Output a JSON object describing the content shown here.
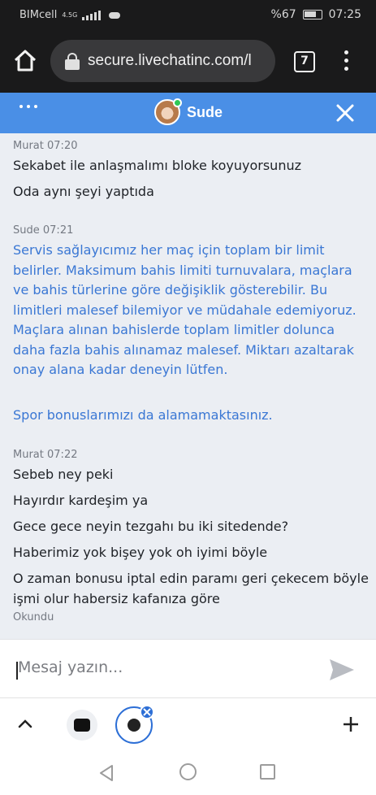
{
  "status_bar": {
    "carrier": "BIMcell",
    "network": "4.5G",
    "battery": "%67",
    "time": "07:25"
  },
  "browser": {
    "url": "secure.livechatinc.com/l",
    "tab_count": "7",
    "icons": {
      "home": "home-icon",
      "lock": "lock-icon",
      "menu": "kebab-menu-icon"
    }
  },
  "chat_header": {
    "agent_name": "Sude",
    "status": "online",
    "colors": {
      "header_bg": "#4a8fe6",
      "online": "#2ec956"
    }
  },
  "messages": [
    {
      "author": "Murat",
      "time": "07:20",
      "role": "visitor",
      "lines": [
        "Sekabet ile anlaşmalımı bloke koyuyorsunuz",
        "Oda aynı şeyi yaptıda"
      ]
    },
    {
      "author": "Sude",
      "time": "07:21",
      "role": "agent",
      "lines": [
        "Servis sağlayıcımız her maç için toplam bir limit belirler. Maksimum bahis limiti turnuvalara, maçlara ve bahis türlerine göre değişiklik gösterebilir. Bu limitleri malesef bilemiyor ve müdahale edemiyoruz. Maçlara alınan bahislerde toplam limitler dolunca daha fazla bahis alınamaz malesef. Miktarı azaltarak onay alana kadar deneyin lütfen.",
        "Spor bonuslarımızı da alamamaktasınız."
      ]
    },
    {
      "author": "Murat",
      "time": "07:22",
      "role": "visitor",
      "lines": [
        "Sebeb ney peki",
        "Hayırdır kardeşim ya",
        "Gece gece neyin tezgahı bu iki sitedende?",
        "Haberimiz yok bişey yok oh iyimi böyle",
        "O zaman bonusu iptal edin paramı geri çekecem böyle işmi olur habersiz kafanıza göre"
      ],
      "receipt": "Okundu"
    }
  ],
  "composer": {
    "placeholder": "Mesaj yazın...",
    "value": ""
  },
  "toolbar": {
    "icons": [
      "chevron-up-icon",
      "app-icon",
      "chat-bubble-icon",
      "plus-icon"
    ]
  },
  "nav": {
    "icons": [
      "back-icon",
      "home-circle-icon",
      "recent-apps-icon"
    ]
  },
  "colors": {
    "agent_text": "#3a77d4",
    "visitor_text": "#1f2227",
    "chat_bg": "#ebeef3"
  }
}
